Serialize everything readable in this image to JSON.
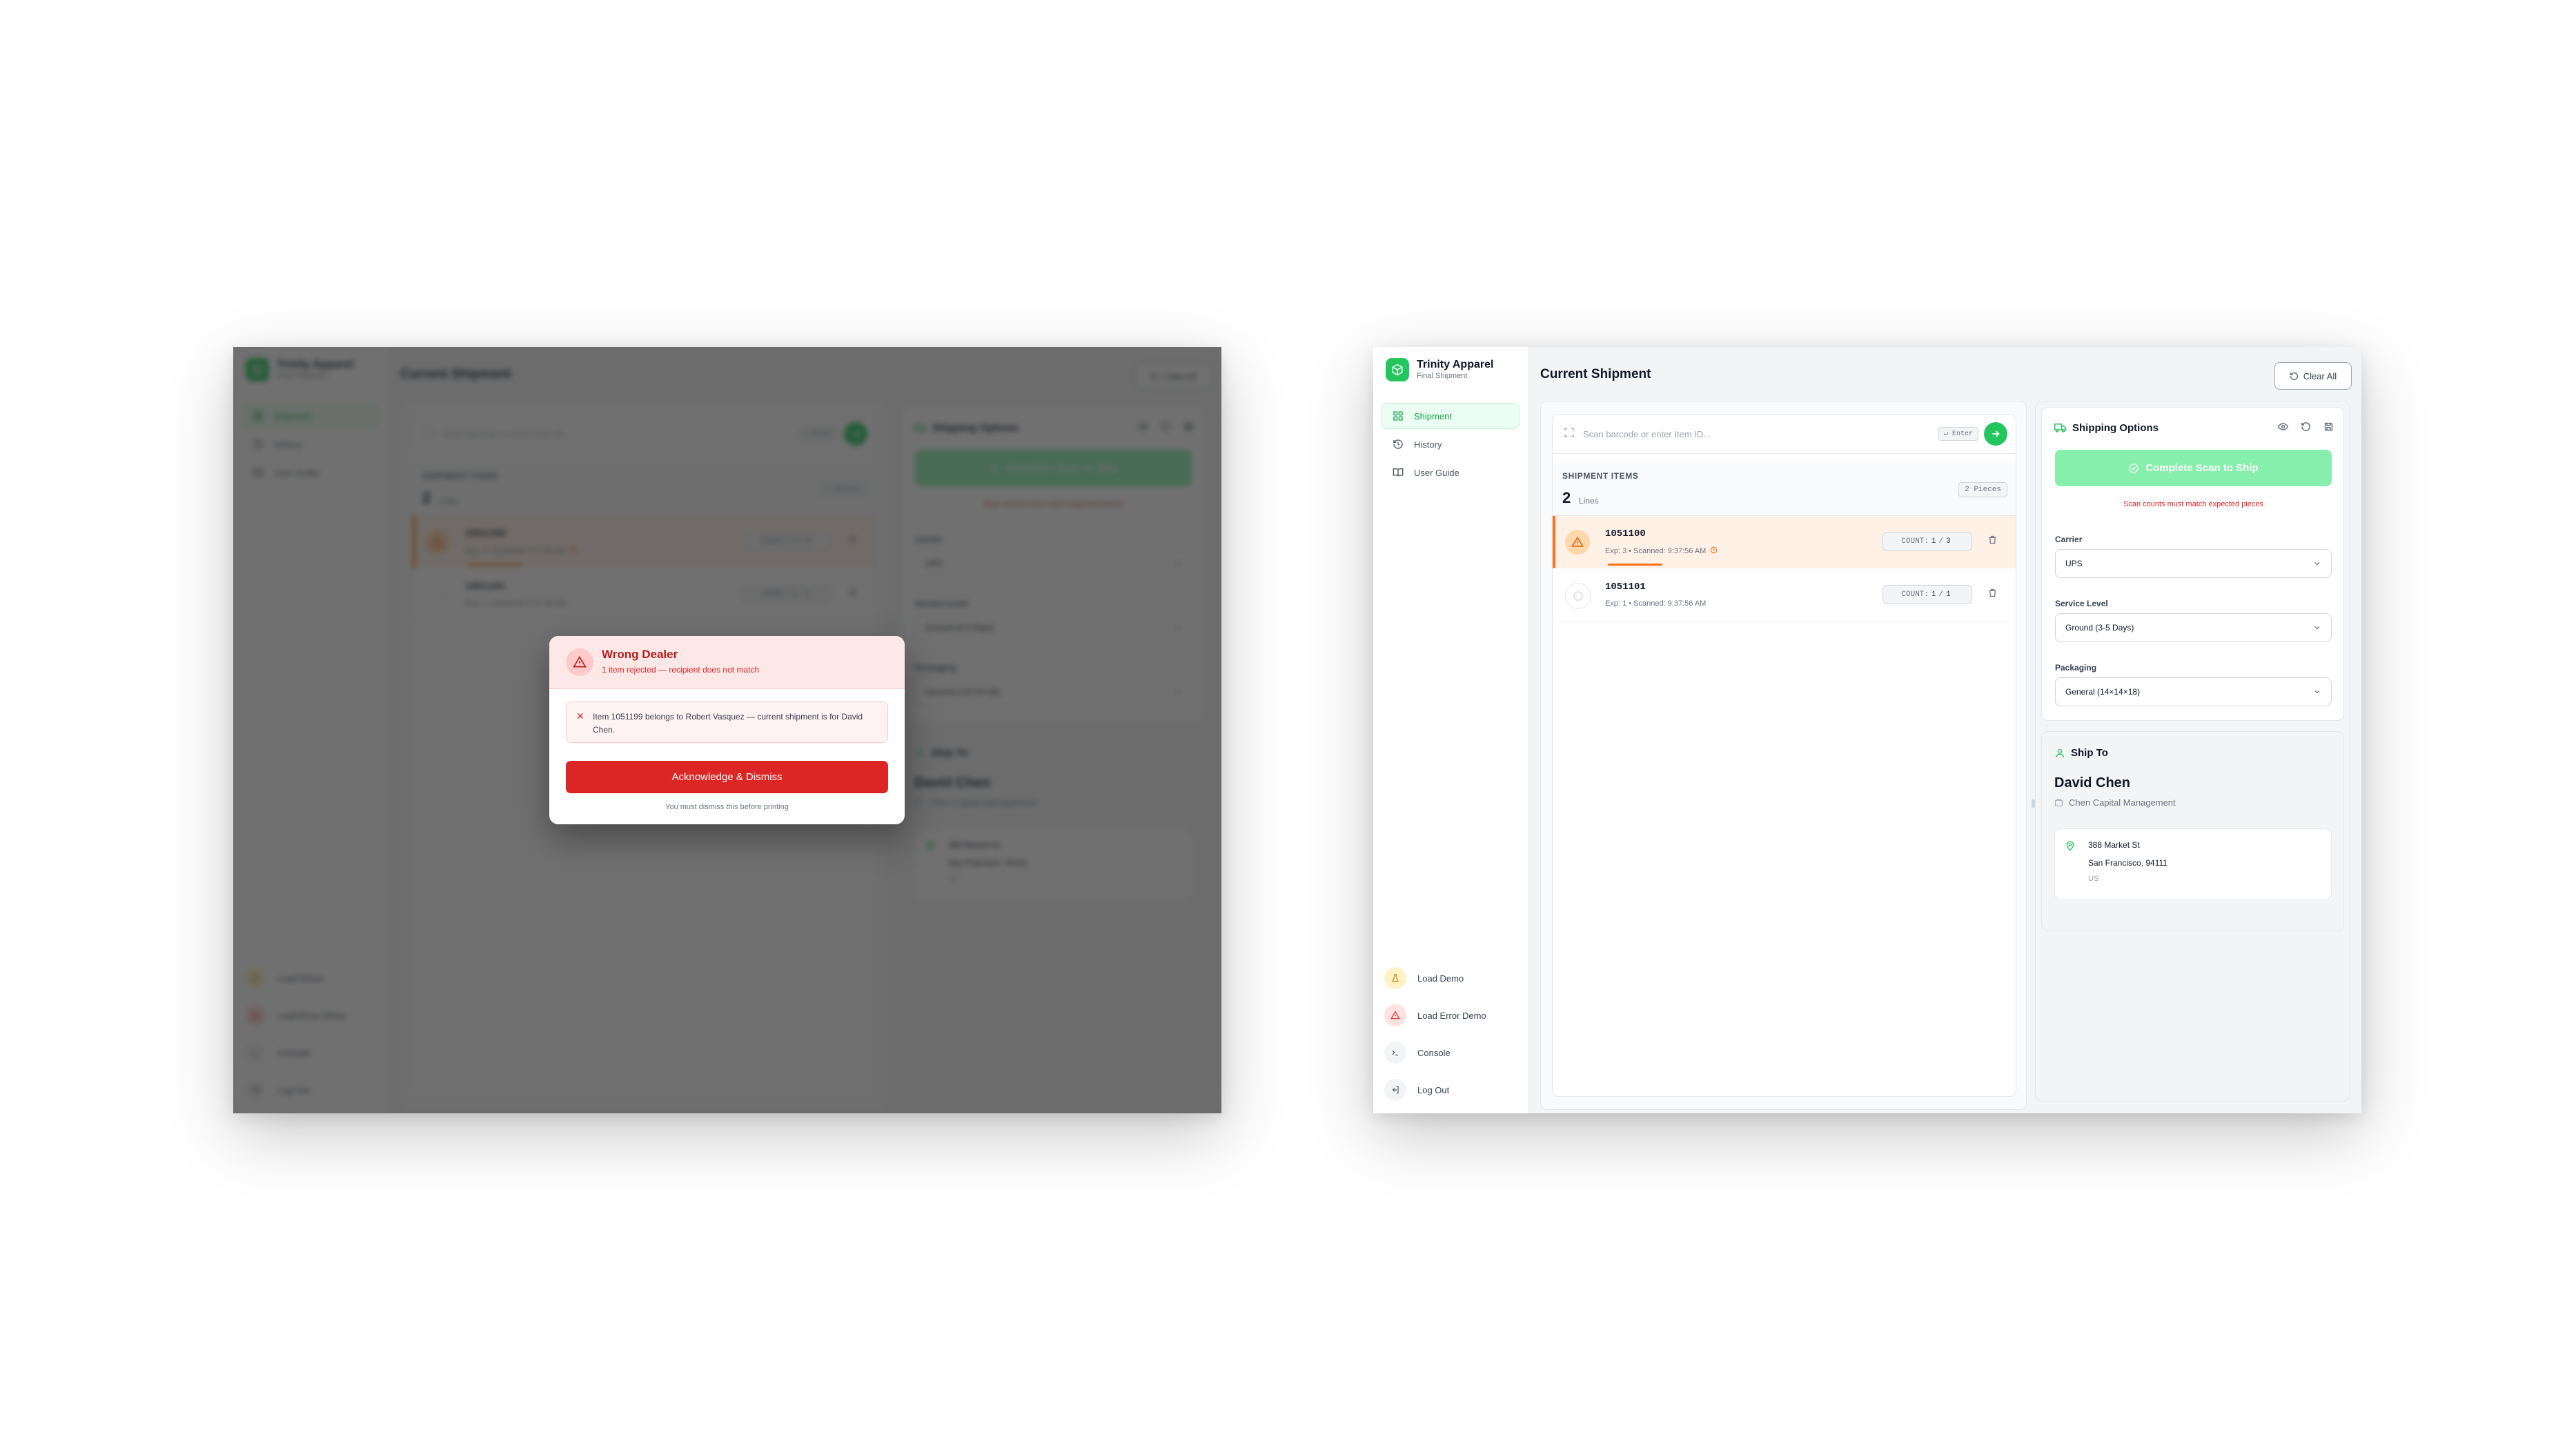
{
  "brand": {
    "name": "Trinity Apparel",
    "subtitle": "Final Shipment"
  },
  "nav": [
    {
      "label": "Shipment",
      "icon": "grid-icon",
      "active": true
    },
    {
      "label": "History",
      "icon": "history-icon",
      "active": false
    },
    {
      "label": "User Guide",
      "icon": "book-icon",
      "active": false
    }
  ],
  "footer_nav": [
    {
      "label": "Load Demo",
      "icon": "flask-icon"
    },
    {
      "label": "Load Error Demo",
      "icon": "alert-triangle-icon"
    },
    {
      "label": "Console",
      "icon": "terminal-icon"
    },
    {
      "label": "Log Out",
      "icon": "logout-icon"
    }
  ],
  "header": {
    "title": "Current Shipment",
    "clear_label": "Clear All"
  },
  "scan": {
    "placeholder": "Scan barcode or enter Item ID...",
    "enter_hint": "↵ Enter"
  },
  "items": {
    "heading": "SHIPMENT ITEMS",
    "lines_count": "2",
    "lines_label": "Lines",
    "pieces": "2 Pieces",
    "count_label": "COUNT:",
    "rows": [
      {
        "id": "1051100",
        "meta": "Exp: 3 • Scanned: 9:37:56 AM",
        "scanned": "1",
        "expected": "3",
        "status": "warning",
        "progress": 0.33
      },
      {
        "id": "1051101",
        "meta": "Exp: 1 • Scanned: 9:37:56 AM",
        "scanned": "1",
        "expected": "1",
        "status": "ok",
        "progress": 1
      }
    ]
  },
  "shipping_options": {
    "title": "Shipping Options",
    "complete_label": "Complete Scan to Ship",
    "error": "Scan counts must match expected pieces",
    "fields": [
      {
        "label": "Carrier",
        "value": "UPS"
      },
      {
        "label": "Service Level",
        "value": "Ground (3-5 Days)"
      },
      {
        "label": "Packaging",
        "value": "General (14×14×18)"
      }
    ]
  },
  "ship_to": {
    "title": "Ship To",
    "name": "David Chen",
    "company": "Chen Capital Management",
    "address_line1": "388 Market St",
    "address_line2": "San Francisco, 94111",
    "country": "US"
  },
  "modal": {
    "title": "Wrong Dealer",
    "subtitle": "1 item rejected — recipient does not match",
    "message": "Item 1051199 belongs to Robert Vasquez — current shipment is for David Chen.",
    "button": "Acknowledge & Dismiss",
    "hint": "You must dismiss this before printing"
  },
  "colors": {
    "accent": "#22c55e",
    "warning": "#f97316",
    "error": "#dc2626"
  }
}
